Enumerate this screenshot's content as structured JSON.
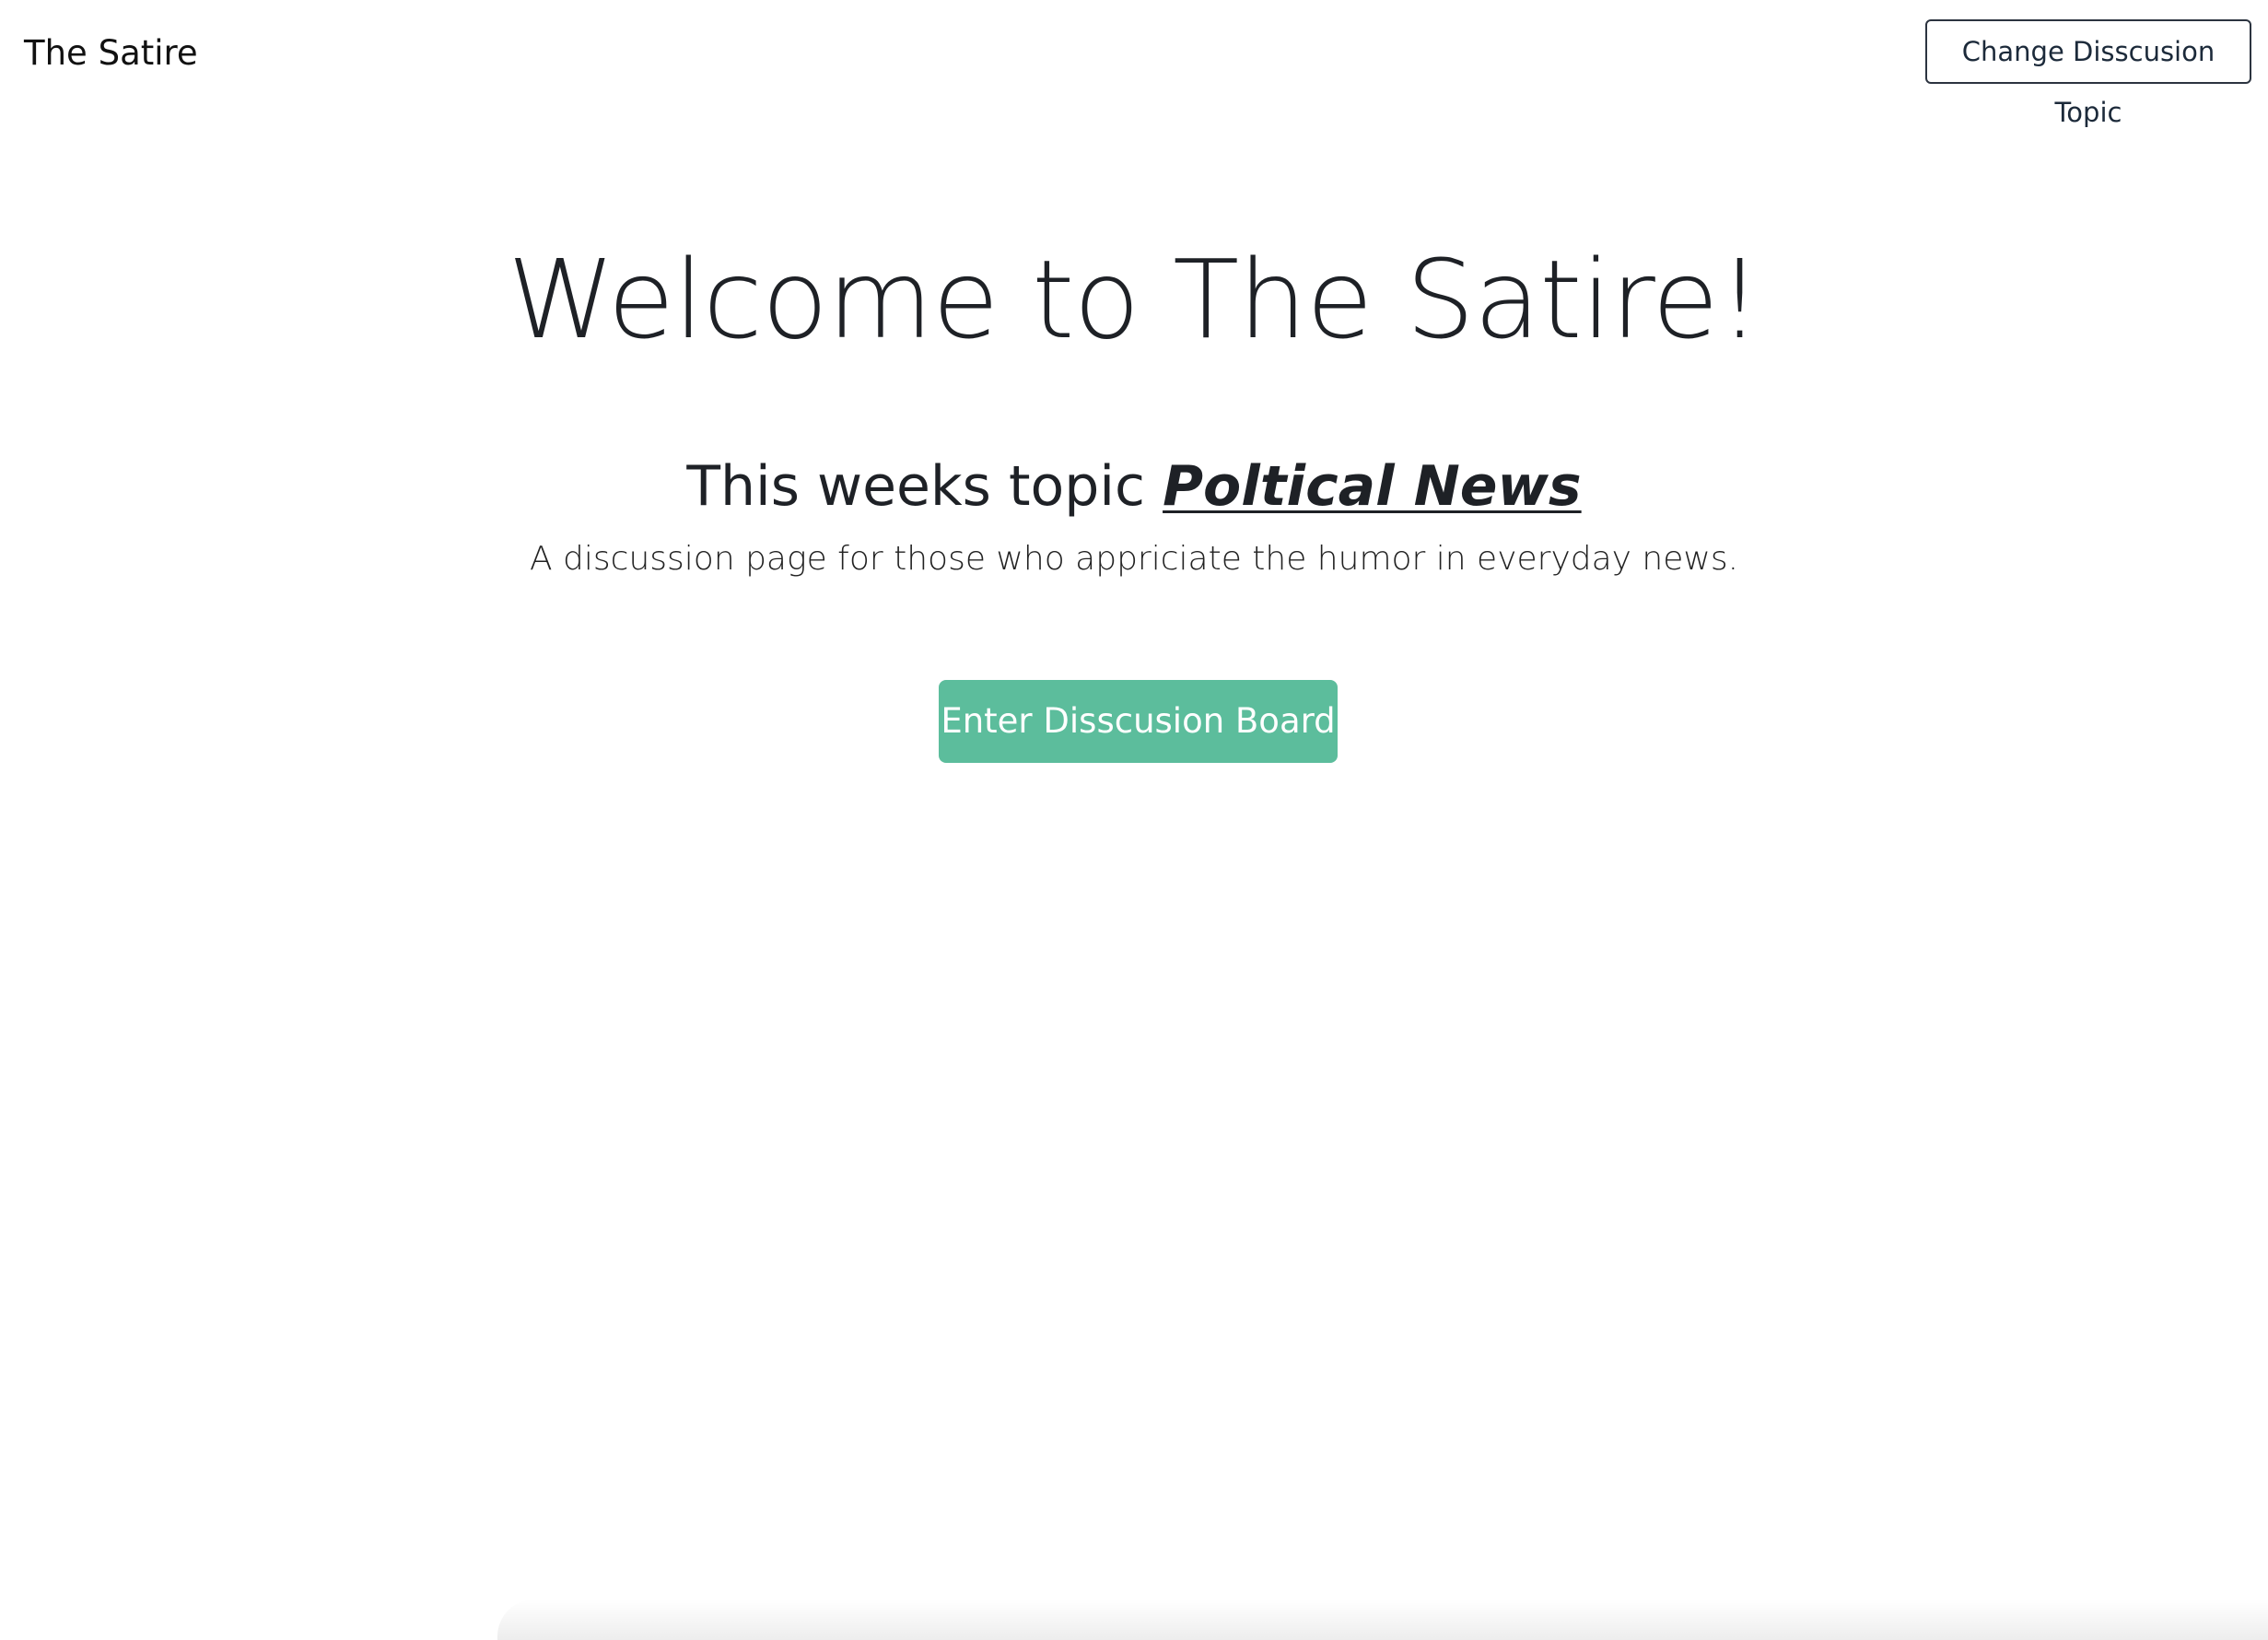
{
  "navbar": {
    "brand": "The Satire",
    "change_topic_label": "Change Disscusion Topic"
  },
  "hero": {
    "title": "Welcome to The Satire!",
    "topic_prefix": "This weeks topic ",
    "topic_name": "Poltical News",
    "subtitle": "A discussion page for those who appriciate the humor in everyday news.",
    "enter_label": "Enter Disscusion Board"
  },
  "colors": {
    "accent": "#5cbd9c",
    "text": "#1e2126",
    "background": "#ffffff"
  }
}
